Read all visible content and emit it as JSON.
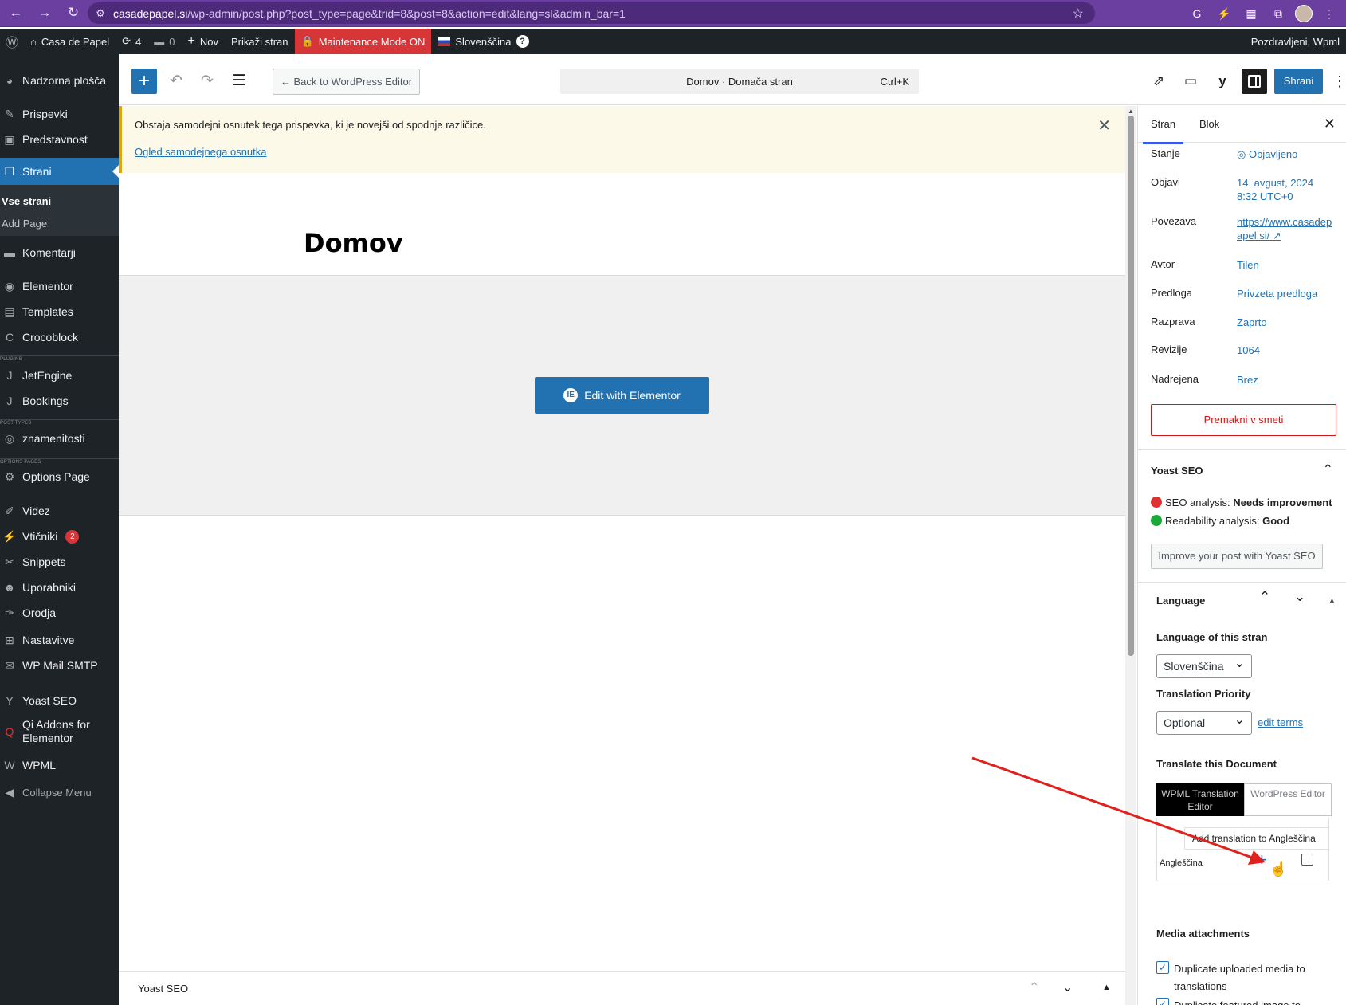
{
  "browser": {
    "url_host": "casadepapel.si",
    "url_path": "/wp-admin/post.php?post_type=page&trid=8&post=8&action=edit&lang=sl&admin_bar=1"
  },
  "admin_bar": {
    "site_name": "Casa de Papel",
    "updates_count": "4",
    "comments_count": "0",
    "new_label": "Nov",
    "view_label": "Prikaži stran",
    "maintenance_label": "Maintenance Mode ON",
    "language_label": "Slovenščina",
    "greeting": "Pozdravljeni, Wpml"
  },
  "sidebar": {
    "items": [
      {
        "label": "Nadzorna plošča",
        "icon": "dashboard-icon"
      },
      {
        "label": "Prispevki",
        "icon": "pin-icon"
      },
      {
        "label": "Predstavnost",
        "icon": "media-icon"
      },
      {
        "label": "Strani",
        "icon": "pages-icon"
      },
      {
        "label": "Komentarji",
        "icon": "comment-icon"
      },
      {
        "label": "Elementor",
        "icon": "elementor-icon"
      },
      {
        "label": "Templates",
        "icon": "folder-icon"
      },
      {
        "label": "Crocoblock",
        "icon": "crocoblock-icon"
      },
      {
        "label": "JetEngine",
        "icon": "jet-icon"
      },
      {
        "label": "Bookings",
        "icon": "jet-icon"
      },
      {
        "label": "znamenitosti",
        "icon": "eye-icon"
      },
      {
        "label": "Options Page",
        "icon": "gear-icon"
      },
      {
        "label": "Videz",
        "icon": "brush-icon"
      },
      {
        "label": "Vtičniki",
        "icon": "plugin-icon"
      },
      {
        "label": "Snippets",
        "icon": "scissors-icon"
      },
      {
        "label": "Uporabniki",
        "icon": "user-icon"
      },
      {
        "label": "Orodja",
        "icon": "wrench-icon"
      },
      {
        "label": "Nastavitve",
        "icon": "settings-icon"
      },
      {
        "label": "WP Mail SMTP",
        "icon": "mail-icon"
      },
      {
        "label": "Yoast SEO",
        "icon": "yoast-icon"
      },
      {
        "label": "Qi Addons for Elementor",
        "icon": "qi-icon"
      },
      {
        "label": "WPML",
        "icon": "wpml-icon"
      },
      {
        "label": "Collapse Menu",
        "icon": "collapse-icon"
      }
    ],
    "sub_all_pages": "Vse strani",
    "sub_add_page": "Add Page",
    "sep_plugins": "PLUGINS",
    "sep_post_types": "POST TYPES",
    "sep_options_pages": "OPTIONS PAGES",
    "plugins_badge": "2"
  },
  "toolbar": {
    "back_label": "← Back to WordPress Editor",
    "command_title": "Domov · Domača stran",
    "command_shortcut": "Ctrl+K",
    "save_label": "Shrani"
  },
  "notice": {
    "text": "Obstaja samodejni osnutek tega prispevka, ki je novejši od spodnje različice.",
    "link": "Ogled samodejnega osnutka"
  },
  "editor": {
    "post_title": "Domov",
    "elementor_button": "Edit with Elementor",
    "bottom_metabox": "Yoast SEO"
  },
  "panel": {
    "tab_post": "Stran",
    "tab_block": "Blok",
    "rows": [
      {
        "key": "Stanje",
        "value": "Objavljeno"
      },
      {
        "key": "Objavi",
        "value": "14. avgust, 2024 8:32 UTC+0"
      },
      {
        "key": "Povezava",
        "value": "https://www.casadepapel.si/ ↗"
      },
      {
        "key": "Avtor",
        "value": "Tilen"
      },
      {
        "key": "Predloga",
        "value": "Privzeta predloga"
      },
      {
        "key": "Razprava",
        "value": "Zaprto"
      },
      {
        "key": "Revizije",
        "value": "1064"
      },
      {
        "key": "Nadrejena",
        "value": "Brez"
      }
    ],
    "trash_label": "Premakni v smeti",
    "yoast_title": "Yoast SEO",
    "seo_label": "SEO analysis: ",
    "seo_value": "Needs improvement",
    "readability_label": "Readability analysis: ",
    "readability_value": "Good",
    "yoast_button": "Improve your post with Yoast SEO",
    "language_title": "Language",
    "language_of_label": "Language of this stran",
    "language_value": "Slovenščina",
    "priority_label": "Translation Priority",
    "priority_value": "Optional",
    "edit_terms": "edit terms",
    "translate_label": "Translate this Document",
    "wpml_editor": "WPML Translation Editor",
    "wp_editor": "WordPress Editor",
    "tooltip": "Add translation to Angleščina",
    "target_language": "Angleščina",
    "media_title": "Media attachments",
    "media_option_1": "Duplicate uploaded media to translations",
    "media_option_2": "Duplicate featured image to"
  }
}
